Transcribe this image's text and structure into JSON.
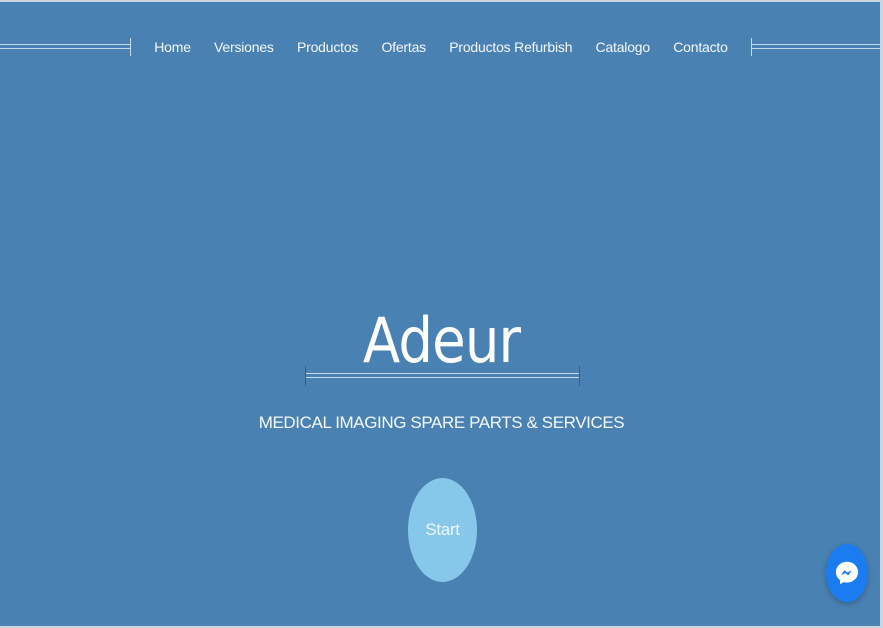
{
  "nav": {
    "items": [
      {
        "label": "Home"
      },
      {
        "label": "Versiones"
      },
      {
        "label": "Productos"
      },
      {
        "label": "Ofertas"
      },
      {
        "label": "Productos Refurbish"
      },
      {
        "label": "Catalogo"
      },
      {
        "label": "Contacto"
      }
    ]
  },
  "hero": {
    "title": "Adeur",
    "subtitle": "MEDICAL IMAGING SPARE PARTS & SERVICES",
    "start_label": "Start"
  },
  "widgets": {
    "messenger_icon": "messenger-icon"
  },
  "colors": {
    "background": "#4a81b3",
    "start_button": "#87c8ea",
    "messenger": "#1a7cf0"
  }
}
